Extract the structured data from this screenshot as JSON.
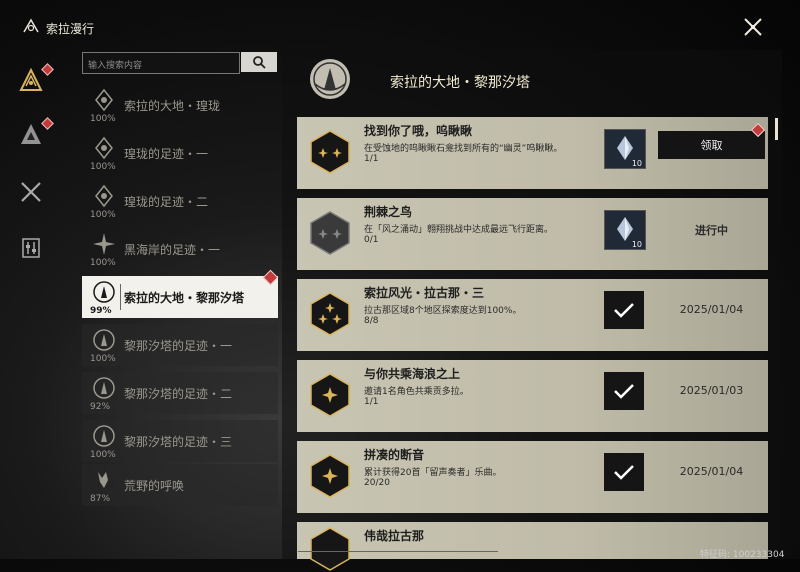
{
  "app": {
    "title": "索拉漫行",
    "logo_icon": "crescent-logo-icon",
    "close_icon": "close-icon"
  },
  "nav": {
    "items": [
      {
        "name": "triangle-emblem-gold",
        "active": true
      },
      {
        "name": "triangle-emblem-dark",
        "active": false
      },
      {
        "name": "crossed-swords",
        "active": false
      },
      {
        "name": "equalizer",
        "active": false
      }
    ]
  },
  "search": {
    "placeholder": "输入搜索内容",
    "icon": "search-icon"
  },
  "categories": [
    {
      "label": "索拉的大地・瑝珑",
      "percent": "100%"
    },
    {
      "label": "瑝珑的足迹・一",
      "percent": "100%"
    },
    {
      "label": "瑝珑的足迹・二",
      "percent": "100%"
    },
    {
      "label": "黑海岸的足迹・一",
      "percent": "100%"
    },
    {
      "label": "索拉的大地・黎那汐塔",
      "percent": "99%",
      "active": true
    },
    {
      "label": "黎那汐塔的足迹・一",
      "percent": "100%"
    },
    {
      "label": "黎那汐塔的足迹・二",
      "percent": "92%"
    },
    {
      "label": "黎那汐塔的足迹・三",
      "percent": "100%"
    },
    {
      "label": "荒野的呼唤",
      "percent": "87%"
    }
  ],
  "main": {
    "title": "索拉的大地・黎那汐塔",
    "achievements": [
      {
        "title": "找到你了哦，呜瞅瞅",
        "desc": "在受蚀地的呜瞅瞅石龛找到所有的“幽灵”呜瞅瞅。",
        "progress": "1/1",
        "reward_count": "10",
        "state": "claim",
        "action": "领取",
        "stars": 2
      },
      {
        "title": "荆棘之鸟",
        "desc": "在「风之涌动」翱翔挑战中达成最远飞行距离。",
        "progress": "0/1",
        "reward_count": "10",
        "state": "in-progress",
        "action": "进行中",
        "stars": 2
      },
      {
        "title": "索拉风光・拉古那・三",
        "desc": "拉古那区域8个地区探索度达到100%。",
        "progress": "8/8",
        "state": "done",
        "action": "2025/01/04",
        "stars": 3
      },
      {
        "title": "与你共乘海浪之上",
        "desc": "邀请1名角色共乘贡多拉。",
        "progress": "1/1",
        "state": "done",
        "action": "2025/01/03",
        "stars": 1
      },
      {
        "title": "拼凑的断音",
        "desc": "累计获得20首「留声奏者」乐曲。",
        "progress": "20/20",
        "state": "done",
        "action": "2025/01/04",
        "stars": 1
      },
      {
        "title": "伟哉拉古那",
        "desc": "",
        "progress": "",
        "state": "partial",
        "action": "",
        "stars": 1
      }
    ]
  },
  "footer": {
    "uid": "特征码: 100233304"
  },
  "colors": {
    "accent_gold": "#d9b45a",
    "badge_red": "#c23a3a",
    "card_bg": "#c9c5b3",
    "active_item": "#f3f1eb"
  }
}
